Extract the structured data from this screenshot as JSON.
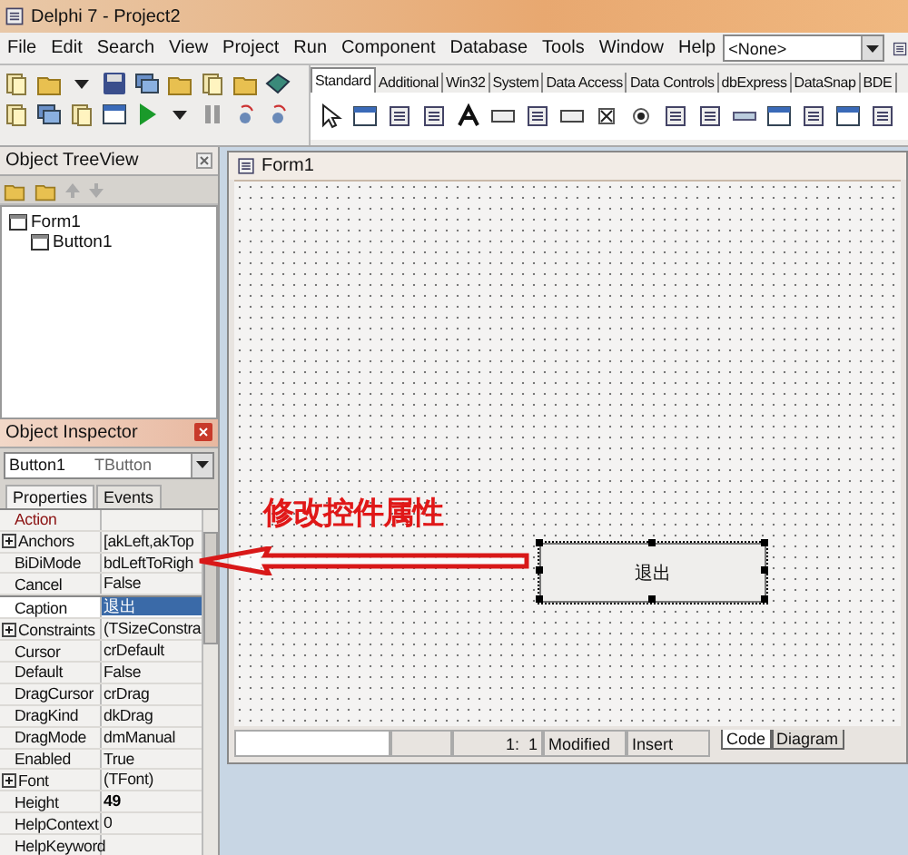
{
  "window": {
    "title": "Delphi 7 - Project2"
  },
  "menu": [
    "File",
    "Edit",
    "Search",
    "View",
    "Project",
    "Run",
    "Component",
    "Database",
    "Tools",
    "Window",
    "Help"
  ],
  "desktop_combo": {
    "value": "<None>"
  },
  "palette": {
    "tabs": [
      {
        "label": "Standard",
        "selected": true
      },
      {
        "label": "Additional",
        "selected": false
      },
      {
        "label": "Win32",
        "selected": false
      },
      {
        "label": "System",
        "selected": false
      },
      {
        "label": "Data Access",
        "selected": false
      },
      {
        "label": "Data Controls",
        "selected": false
      },
      {
        "label": "dbExpress",
        "selected": false
      },
      {
        "label": "DataSnap",
        "selected": false
      },
      {
        "label": "BDE",
        "selected": false
      }
    ]
  },
  "object_treeview": {
    "title": "Object TreeView",
    "tree": [
      {
        "label": "Form1",
        "children": [
          {
            "label": "Button1"
          }
        ]
      }
    ]
  },
  "object_inspector": {
    "title": "Object Inspector",
    "component": {
      "name": "Button1",
      "type": "TButton"
    },
    "tabs": [
      {
        "label": "Properties",
        "selected": true
      },
      {
        "label": "Events",
        "selected": false
      }
    ],
    "properties": [
      {
        "name": "Action",
        "kind": "link",
        "selected": false
      },
      {
        "name": "Anchors",
        "value": "[akLeft,akTop",
        "kind": "expandable",
        "selected": false,
        "modified": false
      },
      {
        "name": "BiDiMode",
        "value": "bdLeftToRigh",
        "kind": "plain",
        "selected": false,
        "modified": false
      },
      {
        "name": "Cancel",
        "value": "False",
        "kind": "plain",
        "selected": false,
        "modified": false
      },
      {
        "name": "Caption",
        "value": "退出",
        "kind": "plain",
        "selected": true,
        "modified": false
      },
      {
        "name": "Constraints",
        "value": "(TSizeConstra",
        "kind": "expandable",
        "selected": false,
        "modified": false
      },
      {
        "name": "Cursor",
        "value": "crDefault",
        "kind": "plain",
        "selected": false,
        "modified": false
      },
      {
        "name": "Default",
        "value": "False",
        "kind": "plain",
        "selected": false,
        "modified": false
      },
      {
        "name": "DragCursor",
        "value": "crDrag",
        "kind": "plain",
        "selected": false,
        "modified": false
      },
      {
        "name": "DragKind",
        "value": "dkDrag",
        "kind": "plain",
        "selected": false,
        "modified": false
      },
      {
        "name": "DragMode",
        "value": "dmManual",
        "kind": "plain",
        "selected": false,
        "modified": false
      },
      {
        "name": "Enabled",
        "value": "True",
        "kind": "plain",
        "selected": false,
        "modified": false
      },
      {
        "name": "Font",
        "value": "(TFont)",
        "kind": "expandable",
        "selected": false,
        "modified": false
      },
      {
        "name": "Height",
        "value": "49",
        "kind": "plain",
        "selected": false,
        "modified": true
      },
      {
        "name": "HelpContext",
        "value": "0",
        "kind": "plain",
        "selected": false,
        "modified": false
      },
      {
        "name": "HelpKeyword",
        "kind": "plain",
        "selected": false
      }
    ]
  },
  "form_designer": {
    "title": "Form1",
    "button": {
      "caption": "退出",
      "selected": true
    },
    "status_bar": {
      "position": "1:  1",
      "state": "Modified",
      "mode": "Insert",
      "tabs": [
        {
          "label": "Code",
          "selected": true
        },
        {
          "label": "Diagram",
          "selected": false
        }
      ]
    }
  },
  "annotation": {
    "text": "修改控件属性"
  }
}
